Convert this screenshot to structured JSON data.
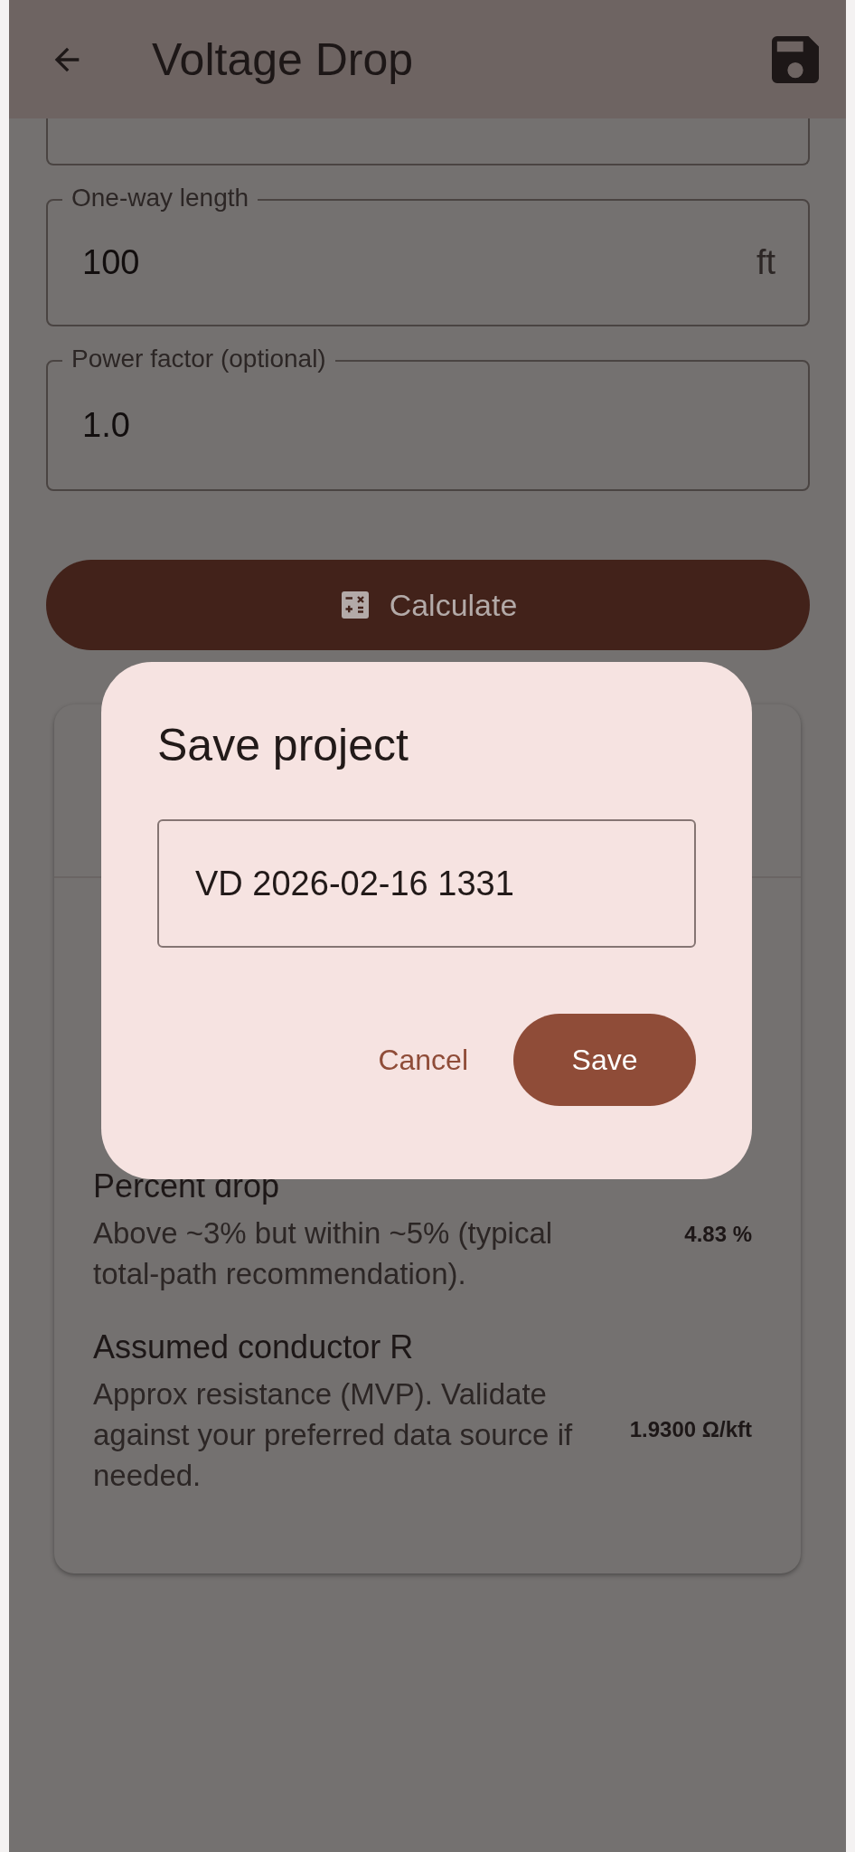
{
  "app_bar": {
    "title": "Voltage Drop"
  },
  "form": {
    "fields": [
      {
        "label": "One-way length",
        "value": "100",
        "suffix": "ft"
      },
      {
        "label": "Power factor (optional)",
        "value": "1.0"
      }
    ],
    "calculate_button": {
      "label": "Calculate"
    }
  },
  "results": {
    "rows": [
      {
        "title": "Percent drop",
        "description": "Above ~3% but within ~5% (typical total-path recommendation).",
        "value": "4.83 %"
      },
      {
        "title": "Assumed conductor R",
        "description": "Approx resistance (MVP). Validate against your preferred data source if needed.",
        "value": "1.9300 Ω/kft"
      }
    ]
  },
  "dialog": {
    "title": "Save project",
    "field": {
      "value": "VD 2026-02-16 1331"
    },
    "buttons": [
      {
        "label": "Cancel",
        "kind": "text"
      },
      {
        "label": "Save",
        "kind": "filled"
      }
    ]
  }
}
